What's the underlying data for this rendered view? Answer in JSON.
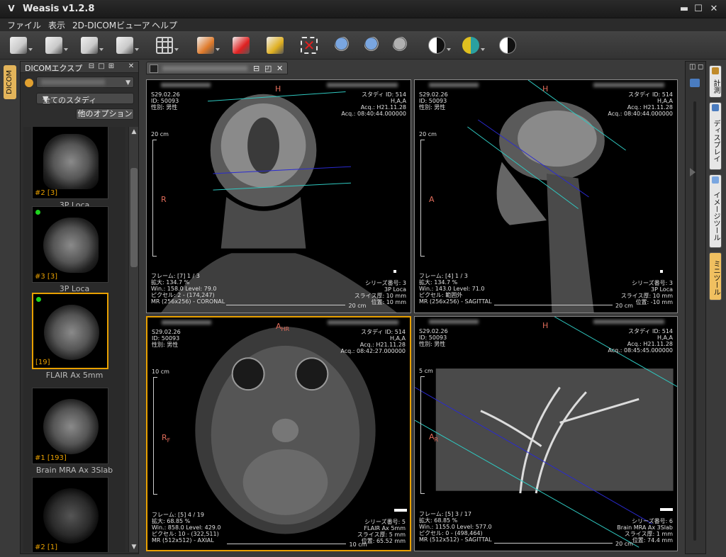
{
  "window": {
    "title": "Weasis v1.2.8",
    "logo_glyph": "V",
    "minimize_glyph": "▬",
    "maximize_glyph": "☐",
    "close_glyph": "✕"
  },
  "menu": [
    "ファイル",
    "表示",
    "2D-DICOMビューア",
    "ヘルプ"
  ],
  "toolbar": {
    "buttons": [
      {
        "name": "open-dicom-cd-icon",
        "color": "#c9c9c9"
      },
      {
        "name": "import-dicom-icon",
        "color": "#c9c9c9"
      },
      {
        "name": "export-dicom-icon",
        "color": "#c9c9c9"
      },
      {
        "name": "dicom-send-icon",
        "color": "#c9c9c9"
      },
      {
        "name": "layout-grid-icon",
        "color": "#d0d0d0"
      },
      {
        "name": "synchronize-icon",
        "color": "#e07a2a"
      },
      {
        "name": "rotate-reset-icon",
        "color": "#e02020"
      },
      {
        "name": "annotation-select-icon",
        "color": "#e0b020"
      },
      {
        "name": "delete-annotation-icon",
        "color": "#e02020"
      },
      {
        "name": "zoom-in-icon",
        "color": "#7aa6e0"
      },
      {
        "name": "zoom-fit-icon",
        "color": "#7aa6e0"
      },
      {
        "name": "zoom-actual-icon",
        "color": "#b0b0b0"
      },
      {
        "name": "window-level-icon",
        "color": "#1a1a1a"
      },
      {
        "name": "lut-color-icon",
        "color": "#2aa0a0"
      },
      {
        "name": "invert-lut-icon",
        "color": "#f0f0f0"
      }
    ]
  },
  "left_vertical_tab": "DICOM",
  "explorer": {
    "title": "DICOMエクスプ",
    "header_buttons": [
      "⊟",
      "□",
      "⊞",
      "✕"
    ],
    "patient_selected_value": "",
    "study_selected_value": "全てのスタディ",
    "options_button": "他のオプション",
    "scroll_up": "▲",
    "scroll_down": "▼",
    "thumbnails": [
      {
        "index": "#2 [3]",
        "label": "3P Loca",
        "green_dot": false,
        "selected": false
      },
      {
        "index": "#3 [3]",
        "label": "3P Loca",
        "green_dot": true,
        "selected": false
      },
      {
        "index": "[19]",
        "label": "FLAIR Ax 5mm",
        "green_dot": true,
        "selected": true
      },
      {
        "index": "#1 [193]",
        "label": "Brain MRA Ax 3Slab",
        "green_dot": false,
        "selected": false
      },
      {
        "index": "#2 [1]",
        "label": "",
        "green_dot": false,
        "selected": false
      }
    ]
  },
  "viewer_tab": {
    "title": "",
    "buttons": [
      "⊟",
      "◰",
      "✕"
    ]
  },
  "panes": [
    {
      "id": "coronal",
      "orient_top": "H",
      "orient_left": "R",
      "scale_label": "20 cm",
      "ruler_label": "20 cm",
      "top_left": "S29.02.26\nID: 50093\n性別: 男性",
      "top_right": "スタディ ID: 514\nH,A,A\nAcq.: H21.11.28\nAcq.: 08:40:44.000000",
      "bottom_left": "フレーム: [7] 1 / 3\n拡大: 134.7 %\nWin.: 158.0 Level: 79.0\nピクセル: 2 - (174,247)\nMR (256x256) - CORONAL",
      "bottom_right": "シリーズ番号: 3\n3P Loca\nスライス厚: 10 mm\n位置: 10 mm"
    },
    {
      "id": "sagittal",
      "orient_top": "H",
      "orient_left": "A",
      "scale_label": "20 cm",
      "ruler_label": "20 cm",
      "top_left": "S29.02.26\nID: 50093\n性別: 男性",
      "top_right": "スタディ ID: 514\nH,A,A\nAcq.: H21.11.28\nAcq.: 08:40:44.000000",
      "bottom_left": "フレーム: [4] 1 / 3\n拡大: 134.7 %\nWin.: 143.0 Level: 71.0\nピクセル: 範囲外\nMR (256x256) - SAGITTAL",
      "bottom_right": "シリーズ番号: 3\n3P Loca\nスライス厚: 10 mm\n位置: -10 mm"
    },
    {
      "id": "axial",
      "orient_top": "A",
      "orient_top_sub": "HR",
      "orient_left": "R",
      "orient_left_sub": "F",
      "scale_label": "10 cm",
      "ruler_label": "10 cm",
      "top_left": "S29.02.26\nID: 50093\n性別: 男性",
      "top_right": "スタディ ID: 514\nH,A,A\nAcq.: H21.11.28\nAcq.: 08:42:27.000000",
      "bottom_left": "フレーム: [5] 4 / 19\n拡大: 68.85 %\nWin.: 858.0 Level: 429.0\nピクセル: 10 - (322,511)\nMR (512x512) - AXIAL",
      "bottom_right": "シリーズ番号: 5\nFLAIR Ax 5mm\nスライス厚: 5 mm\n位置: 65.52 mm"
    },
    {
      "id": "mra",
      "orient_top": "H",
      "orient_left": "A",
      "orient_left_sub": "R",
      "scale_label": "5 cm",
      "ruler_label": "20 cm",
      "top_left": "S29.02.26\nID: 50093\n性別: 男性",
      "top_right": "スタディ ID: 514\nH,A,A\nAcq.: H21.11.28\nAcq.: 08:45:45.000000",
      "bottom_left": "フレーム: [5] 3 / 17\n拡大: 68.85 %\nWin.: 1155.0 Level: 577.0\nピクセル: 0 - (498,464)\nMR (512x512) - SAGITTAL",
      "bottom_right": "シリーズ番号: 6\nBrain MRA Ax 3Slab\nスライス厚: 1 mm\n位置: 74.4 mm"
    }
  ],
  "right_dock": {
    "buttons": [
      "◫",
      "◻"
    ],
    "tabs": [
      "計測",
      "ディスプレイ",
      "イメージツール",
      "ミニツール"
    ]
  },
  "colors": {
    "accent": "#e8a000",
    "orientation": "#e06c5a",
    "reference_line_cyan": "#2fc8c0",
    "reference_line_blue": "#2a2ad0"
  }
}
